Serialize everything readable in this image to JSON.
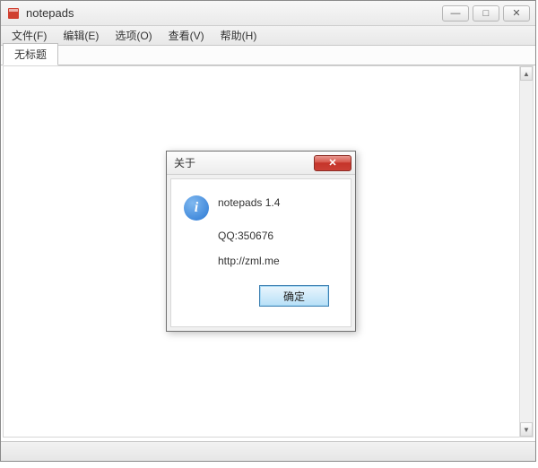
{
  "window": {
    "title": "notepads"
  },
  "menu": {
    "file": "文件(F)",
    "edit": "编辑(E)",
    "options": "选项(O)",
    "view": "查看(V)",
    "help": "帮助(H)"
  },
  "tabs": {
    "untitled": "无标题"
  },
  "dialog": {
    "title": "关于",
    "app_name": "notepads 1.4",
    "qq": "QQ:350676",
    "url": "http://zml.me",
    "ok": "确定"
  },
  "icons": {
    "info_glyph": "i",
    "close_glyph": "✕",
    "min_glyph": "—",
    "max_glyph": "□",
    "up_glyph": "▲",
    "down_glyph": "▼"
  }
}
